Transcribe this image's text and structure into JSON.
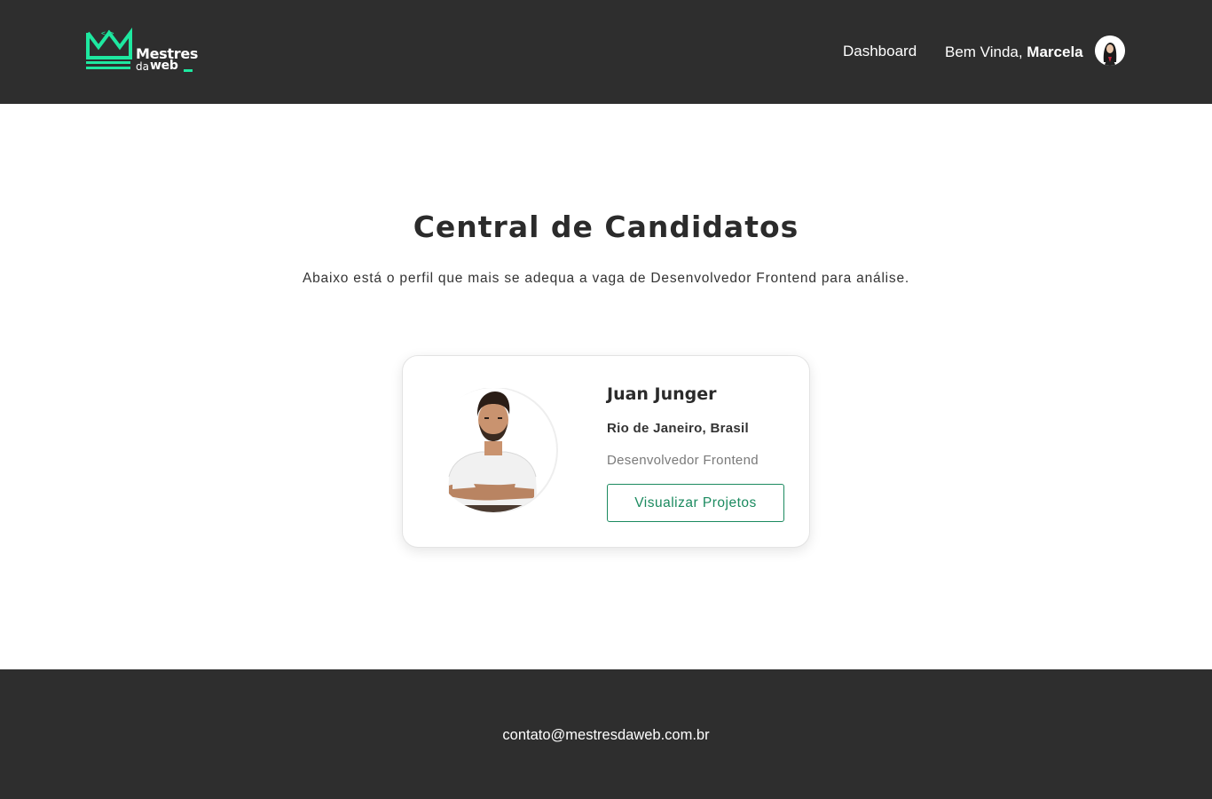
{
  "header": {
    "logo": {
      "line1": "Mestres",
      "line2_prefix": "da",
      "line2_main": "web",
      "brand_color": "#1ee8a0",
      "icon": "crown-code-icon"
    },
    "nav_dashboard": "Dashboard",
    "welcome_prefix": "Bem Vinda, ",
    "user_name": "Marcela",
    "avatar_icon": "user-avatar"
  },
  "main": {
    "title": "Central de Candidatos",
    "subtitle": "Abaixo está o perfil que mais se adequa a vaga de Desenvolvedor Frontend para análise."
  },
  "candidate": {
    "name": "Juan Junger",
    "location": "Rio de Janeiro, Brasil",
    "role": "Desenvolvedor Frontend",
    "button_label": "Visualizar Projetos",
    "accent_color": "#1b8a5f"
  },
  "footer": {
    "email": "contato@mestresdaweb.com.br"
  }
}
